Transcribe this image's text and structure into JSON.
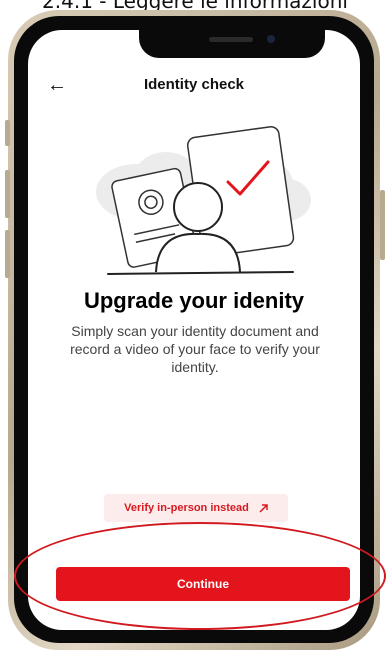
{
  "caption": "2.4.1 - Leggere le informazioni",
  "header": {
    "title": "Identity check",
    "back_icon": "arrow-left-icon"
  },
  "illustration": {
    "icons": [
      "id-card-icon",
      "person-icon",
      "checkmark-icon",
      "cloud-icon"
    ]
  },
  "main": {
    "headline": "Upgrade your idenity",
    "description": "Simply scan your identity document and record a video of your face to verify your identity."
  },
  "actions": {
    "verify_label": "Verify in-person instead",
    "verify_icon": "external-arrow-icon",
    "continue_label": "Continue"
  },
  "colors": {
    "brand_red": "#e3141b",
    "verify_bg": "#fdecec",
    "annotation": "#d11a20"
  }
}
